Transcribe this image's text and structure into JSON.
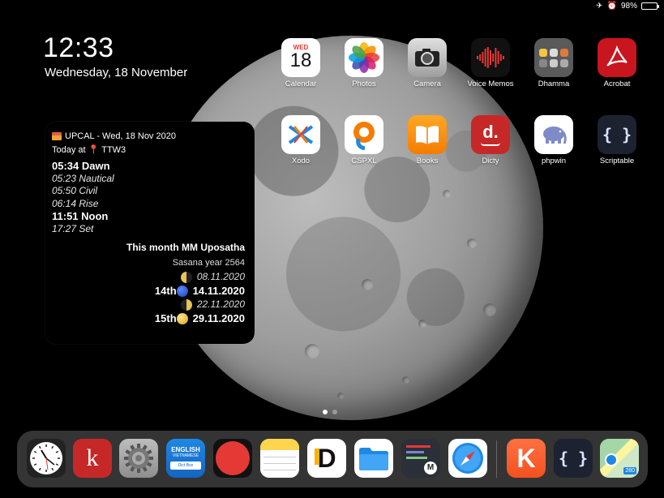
{
  "status": {
    "airplane": "✈",
    "alarm": "⏰",
    "battery": "98%",
    "battery_level": 0.98
  },
  "clock": {
    "time": "12:33",
    "date": "Wednesday, 18 November"
  },
  "widget": {
    "header": "UPCAL - Wed, 18 Nov 2020",
    "location_prefix": "Today at",
    "location": "TTW3",
    "times": [
      {
        "text": "05:34 Dawn",
        "style": "bold"
      },
      {
        "text": "05:23 Nautical",
        "style": "italic"
      },
      {
        "text": "05:50 Civil",
        "style": "italic"
      },
      {
        "text": "06:14 Rise",
        "style": "italic"
      },
      {
        "text": "11:51 Noon",
        "style": "bold"
      },
      {
        "text": "17:27 Set",
        "style": "italic"
      }
    ],
    "month_title": "This month MM Uposatha",
    "sasana_year": "Sasana year 2564",
    "moons": [
      {
        "prefix": "",
        "phase": "first-quarter",
        "date": "08.11.2020",
        "style": "italic"
      },
      {
        "prefix": "14th",
        "phase": "new-moon",
        "date": "14.11.2020",
        "style": "bold"
      },
      {
        "prefix": "",
        "phase": "last-quarter",
        "date": "22.11.2020",
        "style": "italic"
      },
      {
        "prefix": "15th",
        "phase": "full-moon",
        "date": "29.11.2020",
        "style": "bold"
      }
    ]
  },
  "apps": [
    {
      "name": "Calendar",
      "icon": "calendar-icon",
      "day": "WED",
      "num": "18"
    },
    {
      "name": "Photos",
      "icon": "photos-icon"
    },
    {
      "name": "Camera",
      "icon": "camera-icon"
    },
    {
      "name": "Voice Memos",
      "icon": "voice-memos-icon"
    },
    {
      "name": "Dhamma",
      "icon": "folder-icon"
    },
    {
      "name": "Acrobat",
      "icon": "acrobat-icon"
    },
    {
      "name": "Xodo",
      "icon": "xodo-icon"
    },
    {
      "name": "CSPXL",
      "icon": "cspxl-icon"
    },
    {
      "name": "Books",
      "icon": "books-icon"
    },
    {
      "name": "Dicty",
      "icon": "dicty-icon",
      "glyph": "d."
    },
    {
      "name": "phpwin",
      "icon": "elephant-icon"
    },
    {
      "name": "Scriptable",
      "icon": "scriptable-icon",
      "glyph": "{ }"
    }
  ],
  "dock": {
    "items": [
      {
        "icon": "clock-icon"
      },
      {
        "icon": "kindle-k-icon",
        "glyph": "k"
      },
      {
        "icon": "settings-gear-icon"
      },
      {
        "icon": "dictionary-icon",
        "line1": "ENGLISH",
        "line2": "VIETNAMESE",
        "line3": "Dict Box"
      },
      {
        "icon": "record-icon"
      },
      {
        "icon": "notes-icon"
      },
      {
        "icon": "d-app-icon",
        "glyph": "D"
      },
      {
        "icon": "files-icon"
      },
      {
        "icon": "editor-icon",
        "glyph": "M"
      },
      {
        "icon": "safari-icon"
      },
      {
        "icon": "k-app-icon",
        "glyph": "K"
      },
      {
        "icon": "scriptable-icon",
        "glyph": "{ }"
      },
      {
        "icon": "maps-icon",
        "glyph": "280"
      }
    ]
  }
}
